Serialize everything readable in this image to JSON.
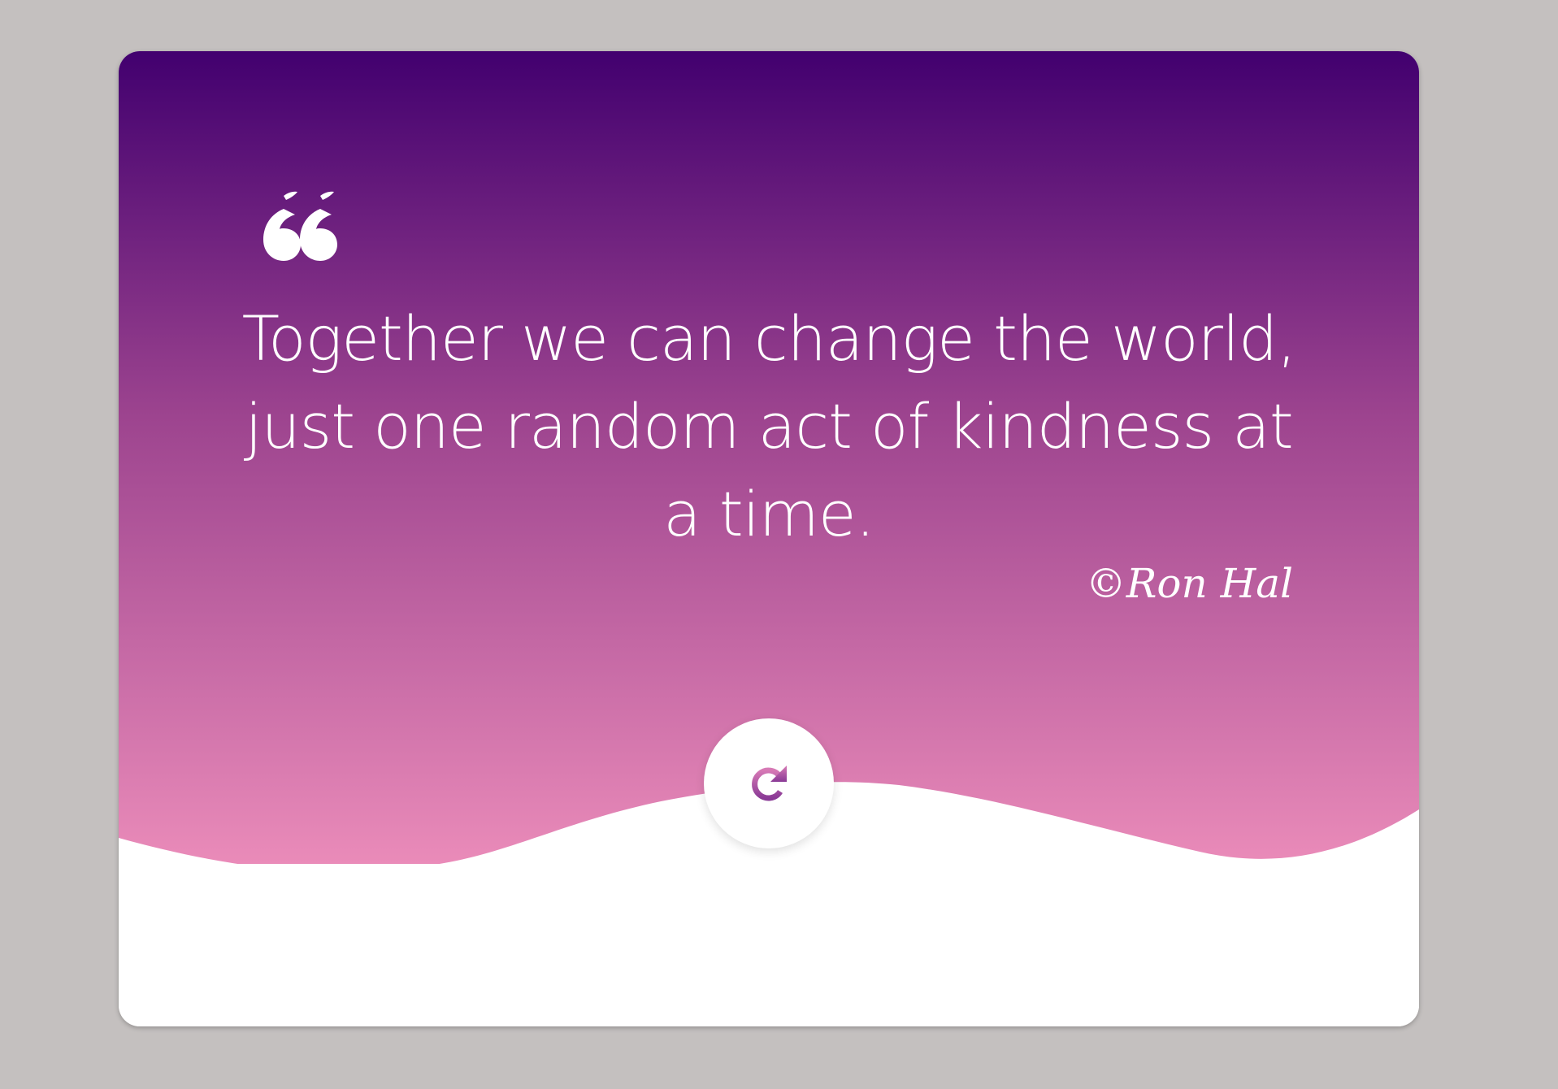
{
  "colors": {
    "page_background": "#c4c0bf",
    "gradient_top": "#42006f",
    "gradient_bottom": "#ea8bb9",
    "card_bottom": "#ffffff",
    "text": "#ffffff"
  },
  "quote": {
    "mark_icon": "quote-open-icon",
    "text": "Together we can change the world, just one random act of kindness at a time.",
    "author": "©Ron Hal"
  },
  "controls": {
    "refresh_icon": "refresh-icon"
  }
}
